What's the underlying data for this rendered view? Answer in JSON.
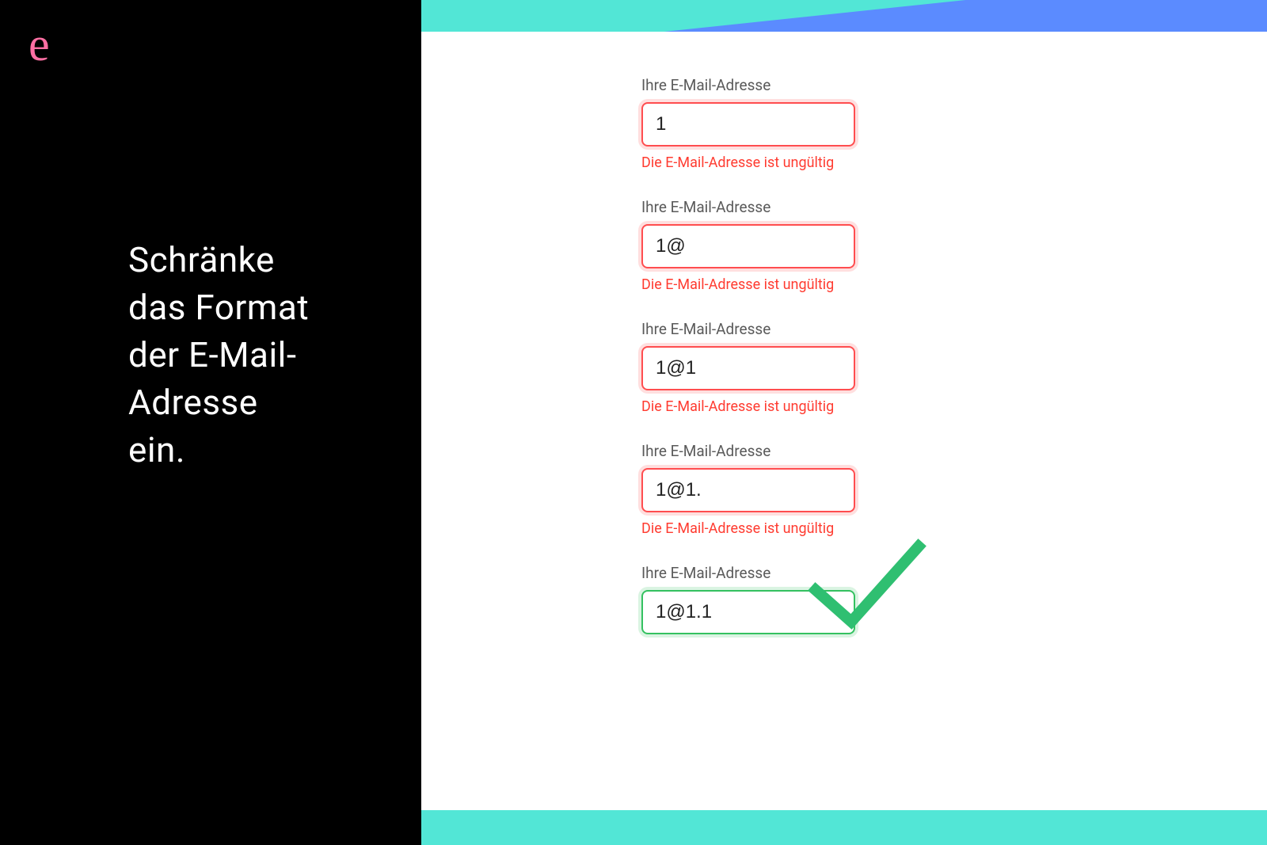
{
  "logo_glyph": "e",
  "headline": "Schränke\ndas Format\nder E-Mail-\nAdresse\nein.",
  "fields": [
    {
      "label": "Ihre E-Mail-Adresse",
      "value": "1",
      "error": "Die E-Mail-Adresse ist ungültig",
      "valid": false
    },
    {
      "label": "Ihre E-Mail-Adresse",
      "value": "1@",
      "error": "Die E-Mail-Adresse ist ungültig",
      "valid": false
    },
    {
      "label": "Ihre E-Mail-Adresse",
      "value": "1@1",
      "error": "Die E-Mail-Adresse ist ungültig",
      "valid": false
    },
    {
      "label": "Ihre E-Mail-Adresse",
      "value": "1@1.",
      "error": "Die E-Mail-Adresse ist ungültig",
      "valid": false
    },
    {
      "label": "Ihre E-Mail-Adresse",
      "value": "1@1.1",
      "error": "",
      "valid": true
    }
  ],
  "colors": {
    "accent_teal": "#52e6d6",
    "accent_blue": "#5b8bff",
    "logo_pink": "#ff6fa3",
    "error_red": "#ff3b30",
    "valid_green": "#2fbf71"
  }
}
